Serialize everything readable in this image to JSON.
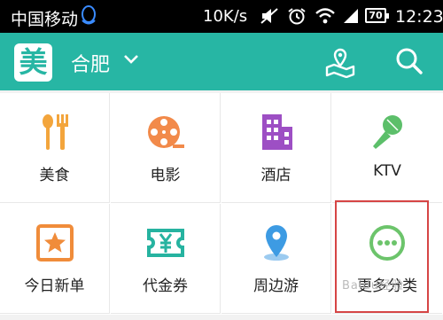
{
  "status_bar": {
    "carrier": "中国移动",
    "speed": "10K/s",
    "battery": "70",
    "time": "12:23"
  },
  "header": {
    "logo": "美",
    "city": "合肥"
  },
  "categories": [
    {
      "label": "美食",
      "icon": "food-icon",
      "color": "#f3a53c"
    },
    {
      "label": "电影",
      "icon": "film-reel-icon",
      "color": "#f28a4a"
    },
    {
      "label": "酒店",
      "icon": "hotel-building-icon",
      "color": "#9d4fc4"
    },
    {
      "label": "KTV",
      "icon": "microphone-icon",
      "color": "#5cbf6a"
    },
    {
      "label": "今日新单",
      "icon": "new-deal-star-icon",
      "color": "#f08c3a"
    },
    {
      "label": "代金券",
      "icon": "voucher-yen-icon",
      "color": "#26b3a0"
    },
    {
      "label": "周边游",
      "icon": "location-pin-icon",
      "color": "#3d9be3"
    },
    {
      "label": "更多分类",
      "icon": "more-dots-icon",
      "color": "#6cc46b"
    }
  ],
  "watermark": "Baidu经验"
}
